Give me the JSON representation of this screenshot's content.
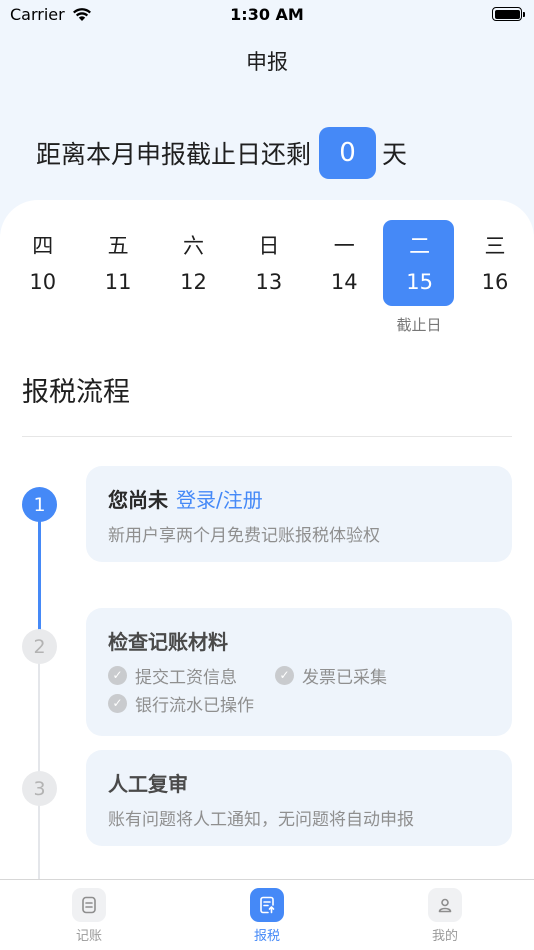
{
  "status_bar": {
    "carrier": "Carrier",
    "time": "1:30 AM"
  },
  "nav": {
    "title": "申报"
  },
  "countdown": {
    "prefix": "距离本月申报截止日还剩",
    "days": "0",
    "suffix": "天"
  },
  "calendar": {
    "days": [
      {
        "weekday": "四",
        "date": "10",
        "selected": false
      },
      {
        "weekday": "五",
        "date": "11",
        "selected": false
      },
      {
        "weekday": "六",
        "date": "12",
        "selected": false
      },
      {
        "weekday": "日",
        "date": "13",
        "selected": false
      },
      {
        "weekday": "一",
        "date": "14",
        "selected": false
      },
      {
        "weekday": "二",
        "date": "15",
        "selected": true
      },
      {
        "weekday": "三",
        "date": "16",
        "selected": false
      }
    ],
    "deadline_label": "截止日"
  },
  "process": {
    "title": "报税流程",
    "steps": [
      {
        "number": "1",
        "title": "您尚未",
        "link": "登录/注册",
        "subtitle": "新用户享两个月免费记账报税体验权"
      },
      {
        "number": "2",
        "title": "检查记账材料",
        "checks": [
          "提交工资信息",
          "发票已采集",
          "银行流水已操作"
        ]
      },
      {
        "number": "3",
        "title": "人工复审",
        "subtitle": "账有问题将人工通知，无问题将自动申报"
      }
    ]
  },
  "tabs": [
    {
      "label": "记账",
      "icon": "notes-icon",
      "active": false
    },
    {
      "label": "报税",
      "icon": "tax-report-icon",
      "active": true
    },
    {
      "label": "我的",
      "icon": "user-icon",
      "active": false
    }
  ],
  "colors": {
    "accent": "#4589f7",
    "page_bg": "#f0f6fd",
    "card_bg": "#eef4fb"
  }
}
